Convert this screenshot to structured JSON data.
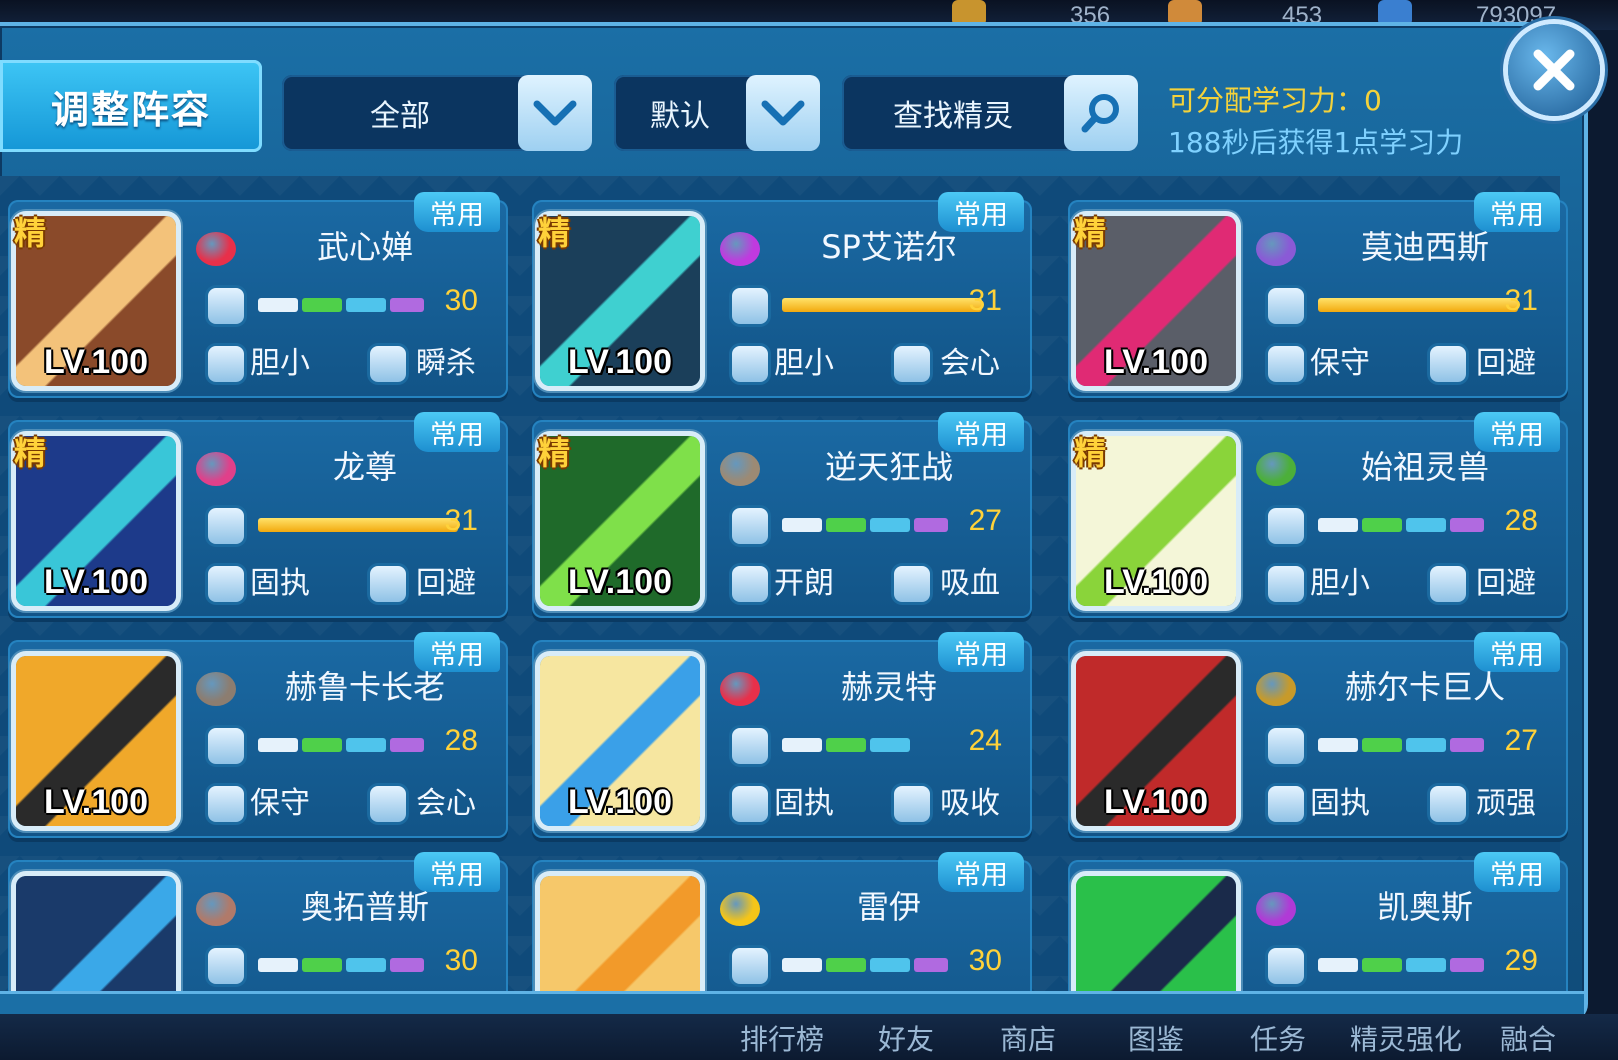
{
  "top_resources": [
    "356",
    "453",
    "793097"
  ],
  "title": "调整阵容",
  "filter": {
    "category": "全部",
    "sort": "默认",
    "search_placeholder": "查找精灵"
  },
  "learning": {
    "line1": "可分配学习力：0",
    "line2": "188秒后获得1点学习力"
  },
  "common_tag": "常用",
  "elite_mark": "精",
  "pets": [
    {
      "name": "武心婵",
      "level": "LV.100",
      "elite": true,
      "learn": "30",
      "nature": "胆小",
      "ability": "瞬杀",
      "bar": "multi",
      "element_color": "#e8304a"
    },
    {
      "name": "SP艾诺尔",
      "level": "LV.100",
      "elite": true,
      "learn": "31",
      "nature": "胆小",
      "ability": "会心",
      "bar": "gold",
      "element_color": "#c03adf"
    },
    {
      "name": "莫迪西斯",
      "level": "LV.100",
      "elite": true,
      "learn": "31",
      "nature": "保守",
      "ability": "回避",
      "bar": "gold",
      "element_color": "#8a5ad6"
    },
    {
      "name": "龙尊",
      "level": "LV.100",
      "elite": true,
      "learn": "31",
      "nature": "固执",
      "ability": "回避",
      "bar": "gold",
      "element_color": "#e0408a"
    },
    {
      "name": "逆天狂战",
      "level": "LV.100",
      "elite": true,
      "learn": "27",
      "nature": "开朗",
      "ability": "吸血",
      "bar": "multi",
      "element_color": "#9c8a74"
    },
    {
      "name": "始祖灵兽",
      "level": "LV.100",
      "elite": true,
      "learn": "28",
      "nature": "胆小",
      "ability": "回避",
      "bar": "multi",
      "element_color": "#4caf3a"
    },
    {
      "name": "赫鲁卡长老",
      "level": "LV.100",
      "elite": false,
      "learn": "28",
      "nature": "保守",
      "ability": "会心",
      "bar": "multi",
      "element_color": "#8c7d70"
    },
    {
      "name": "赫灵特",
      "level": "LV.100",
      "elite": false,
      "learn": "24",
      "nature": "固执",
      "ability": "吸收",
      "bar": "multi3",
      "element_color": "#e8304a"
    },
    {
      "name": "赫尔卡巨人",
      "level": "LV.100",
      "elite": false,
      "learn": "27",
      "nature": "固执",
      "ability": "顽强",
      "bar": "multi",
      "element_color": "#c79a2a"
    },
    {
      "name": "奥拓普斯",
      "level": "",
      "elite": false,
      "learn": "30",
      "nature": "",
      "ability": "",
      "bar": "multi",
      "element_color": "#b07a6a"
    },
    {
      "name": "雷伊",
      "level": "",
      "elite": false,
      "learn": "30",
      "nature": "",
      "ability": "",
      "bar": "multi",
      "element_color": "#f5c518"
    },
    {
      "name": "凯奥斯",
      "level": "",
      "elite": false,
      "learn": "29",
      "nature": "",
      "ability": "",
      "bar": "multi",
      "element_color": "#b03ad6"
    }
  ],
  "bottom_nav": [
    "排行榜",
    "好友",
    "商店",
    "图鉴",
    "任务",
    "精灵强化",
    "融合"
  ]
}
